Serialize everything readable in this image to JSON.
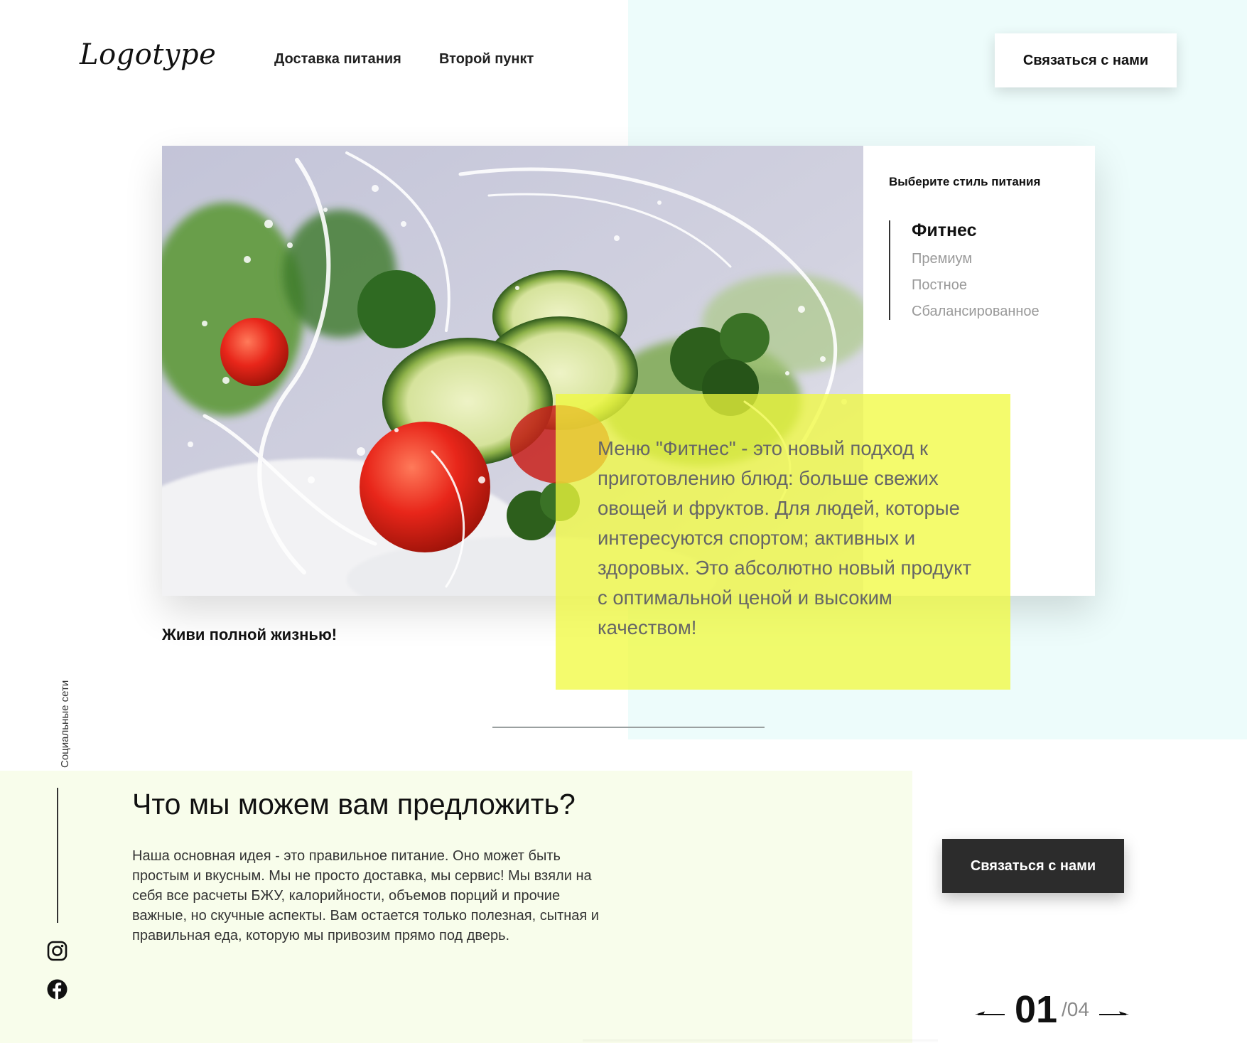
{
  "header": {
    "logo": "Logotype",
    "nav": [
      {
        "label": "Доставка питания"
      },
      {
        "label": "Второй пункт"
      }
    ],
    "contact_button": "Связаться с нами"
  },
  "hero": {
    "image_alt": "vegetables-water-splash-photo",
    "panel_title": "Выберите стиль питания",
    "styles": [
      {
        "label": "Фитнес",
        "active": true
      },
      {
        "label": "Премиум",
        "active": false
      },
      {
        "label": "Постное",
        "active": false
      },
      {
        "label": "Сбалансированное",
        "active": false
      }
    ],
    "description": "Меню \"Фитнес\" - это новый подход к приготовлению блюд: больше свежих овощей и фруктов. Для людей, которые интересуются спортом; активных и здоровых. Это абсолютно новый продукт с оптимальной ценой и высоким качеством!",
    "tagline": "Живи полной жизнью!"
  },
  "social": {
    "label": "Социальные сети",
    "icons": [
      "instagram-icon",
      "facebook-icon"
    ]
  },
  "offer": {
    "title": "Что мы можем вам предложить?",
    "text": "Наша основная идея - это правильное питание. Оно может быть простым и вкусным. Мы не просто доставка, мы сервис! Мы взяли на себя все расчеты БЖУ, калорийности, объемов порций и прочие важные, но скучные аспекты. Вам остается только полезная, сытная и правильная еда, которую мы привозим прямо под дверь.",
    "contact_button": "Связаться с нами"
  },
  "pager": {
    "current": "01",
    "total": "/04"
  },
  "colors": {
    "accent_green": "#4bd83c",
    "highlight_yellow": "#f0fa3c",
    "mint_bg": "#edfcfb",
    "cream_bg": "#f8fdeb",
    "dark_button": "#2c2c2c"
  }
}
